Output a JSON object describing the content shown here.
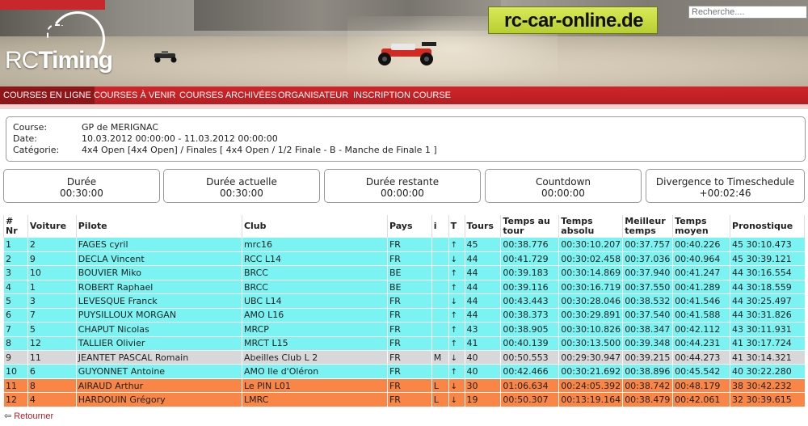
{
  "header": {
    "logo_rc": "RC",
    "logo_timing": "Timing",
    "sponsor": "rc-car-online.de",
    "search_placeholder": "Recherche...."
  },
  "nav": {
    "items": [
      {
        "label": "COURSES EN LIGNE",
        "active": true
      },
      {
        "label": "COURSES À VENIR",
        "active": false
      },
      {
        "label": "COURSES ARCHIVÉES",
        "active": false
      },
      {
        "label": "ORGANISATEUR",
        "active": false
      },
      {
        "label": "INSCRIPTION COURSE",
        "active": false
      }
    ]
  },
  "race": {
    "course_label": "Course:",
    "course": "GP de MERIGNAC",
    "date_label": "Date:",
    "date": "10.03.2012 00:00:00 - 11.03.2012 00:00:00",
    "category_label": "Catégorie:",
    "category": "4x4 Open [4x4 Open] / Finales [ 4x4 Open / 1/2 Finale - B - Manche de Finale 1 ]"
  },
  "stats": [
    {
      "label": "Durée",
      "value": "00:30:00"
    },
    {
      "label": "Durée actuelle",
      "value": "00:30:00"
    },
    {
      "label": "Durée restante",
      "value": "00:00:00"
    },
    {
      "label": "Countdown",
      "value": "00:00:00"
    },
    {
      "label": "Divergence to Timeschedule",
      "value": "+00:02:46"
    }
  ],
  "table": {
    "headers": {
      "pos": "#",
      "nr": "Nr",
      "voiture": "Voiture",
      "pilote": "Pilote",
      "club": "Club",
      "pays": "Pays",
      "i": "i",
      "t": "T",
      "tours": "Tours",
      "temps_tour": "Temps au tour",
      "temps_absolu": "Temps absolu",
      "meilleur": "Meilleur temps",
      "moyen": "Temps moyen",
      "prono": "Pronostique"
    },
    "rows": [
      {
        "pos": "1",
        "voiture": "2",
        "pilote": "FAGES cyril",
        "club": "mrc16",
        "pays": "FR",
        "i": "",
        "trend": "up",
        "tours": "45",
        "tour": "00:38.776",
        "absolu": "00:30:10.207",
        "meilleur": "00:37.757",
        "moyen": "00:40.226",
        "prono": "45 30:10.473",
        "color": "cyan"
      },
      {
        "pos": "2",
        "voiture": "9",
        "pilote": "DECLA Vincent",
        "club": "RCC L14",
        "pays": "FR",
        "i": "",
        "trend": "down",
        "tours": "44",
        "tour": "00:41.729",
        "absolu": "00:30:02.458",
        "meilleur": "00:37.036",
        "moyen": "00:40.964",
        "prono": "45 30:39.121",
        "color": "cyan"
      },
      {
        "pos": "3",
        "voiture": "10",
        "pilote": "BOUVIER Miko",
        "club": "BRCC",
        "pays": "BE",
        "i": "",
        "trend": "up",
        "tours": "44",
        "tour": "00:39.183",
        "absolu": "00:30:14.869",
        "meilleur": "00:37.940",
        "moyen": "00:41.247",
        "prono": "44 30:16.554",
        "color": "cyan"
      },
      {
        "pos": "4",
        "voiture": "1",
        "pilote": "ROBERT Raphael",
        "club": "BRCC",
        "pays": "BE",
        "i": "",
        "trend": "up",
        "tours": "44",
        "tour": "00:39.116",
        "absolu": "00:30:16.719",
        "meilleur": "00:37.550",
        "moyen": "00:41.289",
        "prono": "44 30:18.559",
        "color": "cyan"
      },
      {
        "pos": "5",
        "voiture": "3",
        "pilote": "LEVESQUE Franck",
        "club": "UBC L14",
        "pays": "FR",
        "i": "",
        "trend": "down",
        "tours": "44",
        "tour": "00:43.443",
        "absolu": "00:30:28.046",
        "meilleur": "00:38.532",
        "moyen": "00:41.546",
        "prono": "44 30:25.497",
        "color": "cyan"
      },
      {
        "pos": "6",
        "voiture": "7",
        "pilote": "PUYSILLOUX MORGAN",
        "club": "AMO L16",
        "pays": "FR",
        "i": "",
        "trend": "up",
        "tours": "44",
        "tour": "00:38.373",
        "absolu": "00:30:29.891",
        "meilleur": "00:37.540",
        "moyen": "00:41.588",
        "prono": "44 30:31.826",
        "color": "cyan"
      },
      {
        "pos": "7",
        "voiture": "5",
        "pilote": "CHAPUT Nicolas",
        "club": "MRCP",
        "pays": "FR",
        "i": "",
        "trend": "up",
        "tours": "43",
        "tour": "00:38.905",
        "absolu": "00:30:10.826",
        "meilleur": "00:38.347",
        "moyen": "00:42.112",
        "prono": "43 30:11.931",
        "color": "cyan"
      },
      {
        "pos": "8",
        "voiture": "12",
        "pilote": "TALLIER Olivier",
        "club": "MRCT L15",
        "pays": "FR",
        "i": "",
        "trend": "up",
        "tours": "41",
        "tour": "00:40.139",
        "absolu": "00:30:13.500",
        "meilleur": "00:39.348",
        "moyen": "00:44.231",
        "prono": "41 30:17.724",
        "color": "cyan"
      },
      {
        "pos": "9",
        "voiture": "11",
        "pilote": "JEANTET PASCAL Romain",
        "club": "Abeilles Club L 2",
        "pays": "FR",
        "i": "M",
        "trend": "down",
        "tours": "40",
        "tour": "00:50.553",
        "absolu": "00:29:30.947",
        "meilleur": "00:39.215",
        "moyen": "00:44.273",
        "prono": "41 30:14.321",
        "color": "grey"
      },
      {
        "pos": "10",
        "voiture": "6",
        "pilote": "GUYONNET Antoine",
        "club": "AMO Ile d'Oléron",
        "pays": "FR",
        "i": "",
        "trend": "up",
        "tours": "40",
        "tour": "00:42.466",
        "absolu": "00:30:21.692",
        "meilleur": "00:38.896",
        "moyen": "00:45.542",
        "prono": "40 30:22.280",
        "color": "cyan"
      },
      {
        "pos": "11",
        "voiture": "8",
        "pilote": "AIRAUD Arthur",
        "club": "Le PIN L01",
        "pays": "FR",
        "i": "L",
        "trend": "down",
        "tours": "30",
        "tour": "01:06.634",
        "absolu": "00:24:05.392",
        "meilleur": "00:38.742",
        "moyen": "00:48.179",
        "prono": "38 30:42.232",
        "color": "orange"
      },
      {
        "pos": "12",
        "voiture": "4",
        "pilote": "HARDOUIN Grégory",
        "club": "LMRC",
        "pays": "FR",
        "i": "L",
        "trend": "down",
        "tours": "19",
        "tour": "00:50.307",
        "absolu": "00:13:19.164",
        "meilleur": "00:38.479",
        "moyen": "00:42.061",
        "prono": "32 30:39.615",
        "color": "orange"
      }
    ]
  },
  "footer": {
    "back_label": "Retourner"
  }
}
